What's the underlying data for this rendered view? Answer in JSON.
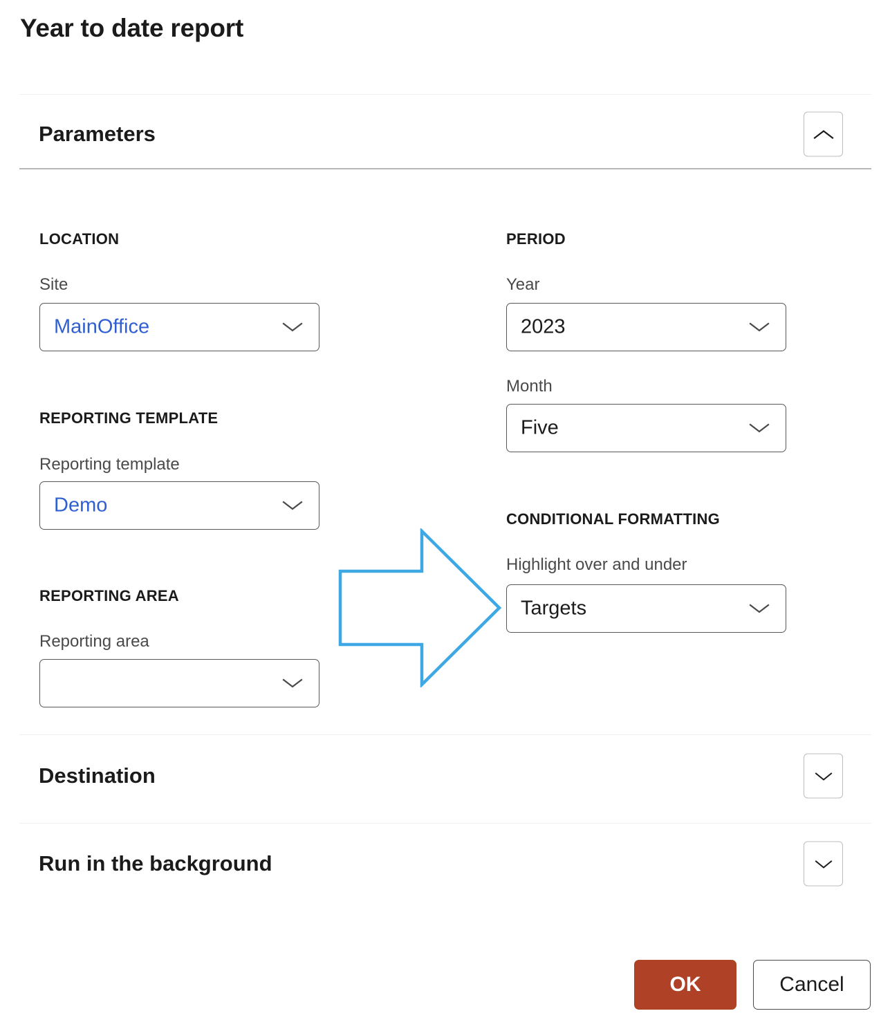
{
  "page": {
    "title": "Year to date report"
  },
  "colors": {
    "accent_button": "#af4226",
    "link_value": "#2f5fd0",
    "annotation_arrow": "#3ea8e5",
    "field_border": "#575757",
    "divider_strong": "#b7b7b7",
    "divider_light": "#f0f0f0"
  },
  "sections": {
    "parameters": {
      "title": "Parameters",
      "toggle_icon": "chevron-up-icon",
      "expanded": true
    },
    "destination": {
      "title": "Destination",
      "toggle_icon": "chevron-down-icon",
      "expanded": false
    },
    "run_in_background": {
      "title": "Run in the background",
      "toggle_icon": "chevron-down-icon",
      "expanded": false
    }
  },
  "groups": {
    "location": {
      "heading": "LOCATION",
      "fields": [
        {
          "label": "Site",
          "value": "MainOffice",
          "placeholder": "",
          "is_link": true,
          "caret_icon": "chevron-down-icon"
        }
      ]
    },
    "reporting_template": {
      "heading": "REPORTING TEMPLATE",
      "fields": [
        {
          "label": "Reporting template",
          "value": "Demo",
          "placeholder": "",
          "is_link": true,
          "caret_icon": "chevron-down-icon"
        }
      ]
    },
    "reporting_area": {
      "heading": "REPORTING AREA",
      "fields": [
        {
          "label": "Reporting area",
          "value": "",
          "placeholder": "",
          "is_link": false,
          "caret_icon": "chevron-down-icon"
        }
      ]
    },
    "period": {
      "heading": "PERIOD",
      "fields": [
        {
          "label": "Year",
          "value": "2023",
          "placeholder": "",
          "is_link": false,
          "caret_icon": "chevron-down-icon"
        },
        {
          "label": "Month",
          "value": "Five",
          "placeholder": "",
          "is_link": false,
          "caret_icon": "chevron-down-icon"
        }
      ]
    },
    "conditional_formatting": {
      "heading": "CONDITIONAL FORMATTING",
      "fields": [
        {
          "label": "Highlight over and under",
          "value": "Targets",
          "placeholder": "",
          "is_link": false,
          "caret_icon": "chevron-down-icon"
        }
      ]
    }
  },
  "annotation": {
    "icon": "right-arrow-outline-annotation",
    "points_to": "Highlight over and under"
  },
  "footer": {
    "ok_label": "OK",
    "cancel_label": "Cancel"
  }
}
